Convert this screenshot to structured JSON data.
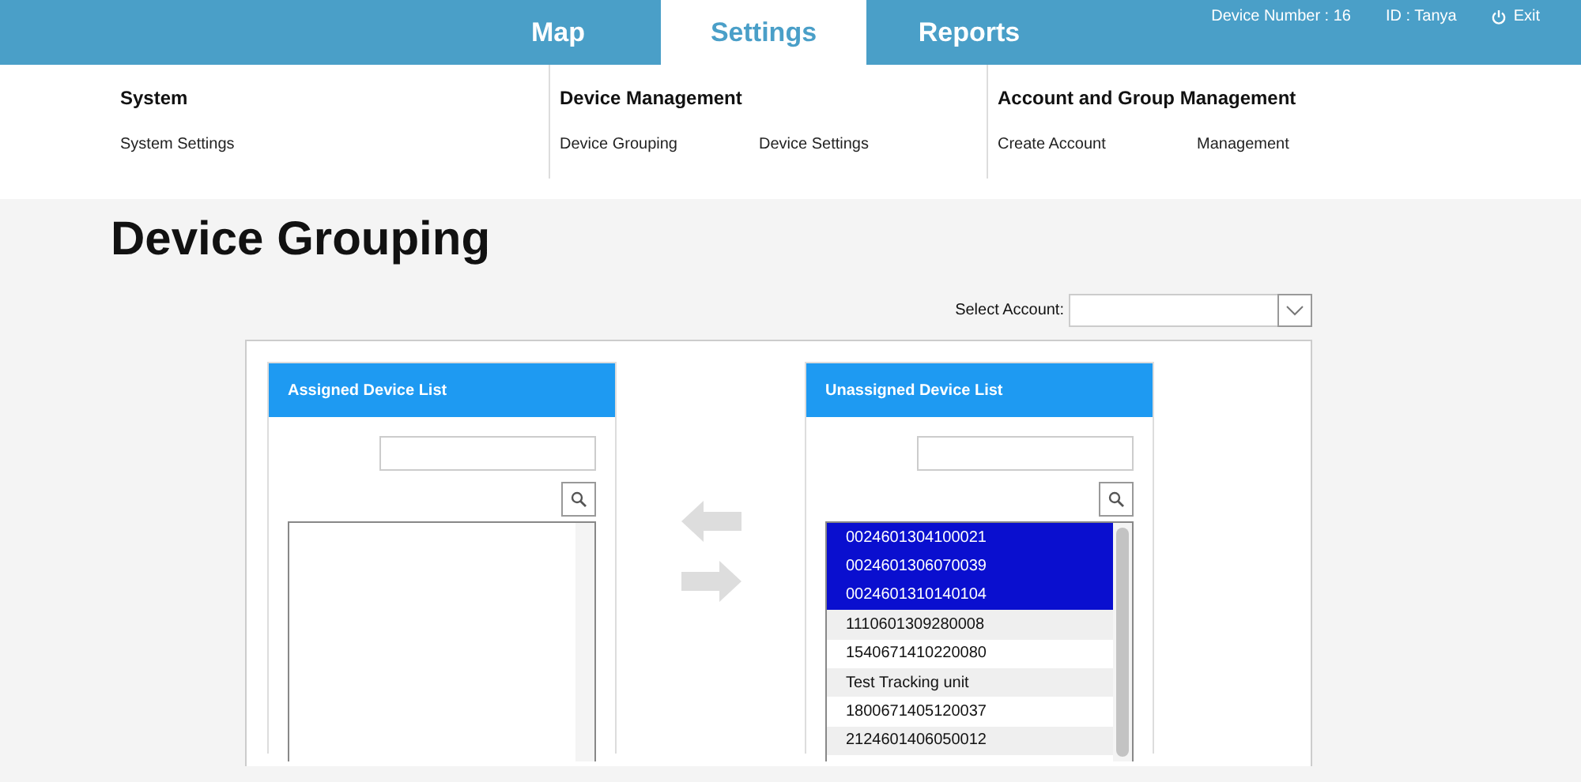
{
  "tabs": [
    {
      "label": "Map",
      "selected": false
    },
    {
      "label": "Settings",
      "selected": true
    },
    {
      "label": "Reports",
      "selected": false
    }
  ],
  "header_info": {
    "device_number": "Device Number : 16",
    "user_id": "ID : Tanya",
    "exit": "Exit"
  },
  "menu": [
    {
      "heading": "System",
      "links": [
        "System Settings"
      ]
    },
    {
      "heading": "Device Management",
      "links": [
        "Device Grouping",
        "Device Settings"
      ]
    },
    {
      "heading": "Account and Group Management",
      "links": [
        "Create Account",
        "Management"
      ]
    }
  ],
  "page_title": "Device Grouping",
  "select_account": {
    "label": "Select Account:"
  },
  "assigned_list": {
    "title": "Assigned Device List"
  },
  "unassigned_list": {
    "title": "Unassigned Device List",
    "items": [
      {
        "label": "0024601304100021",
        "selected": true
      },
      {
        "label": "0024601306070039",
        "selected": true
      },
      {
        "label": "0024601310140104",
        "selected": true
      },
      {
        "label": "1110601309280008",
        "selected": false
      },
      {
        "label": "1540671410220080",
        "selected": false
      },
      {
        "label": "Test Tracking unit",
        "selected": false
      },
      {
        "label": "1800671405120037",
        "selected": false
      },
      {
        "label": "2124601406050012",
        "selected": false
      }
    ]
  }
}
